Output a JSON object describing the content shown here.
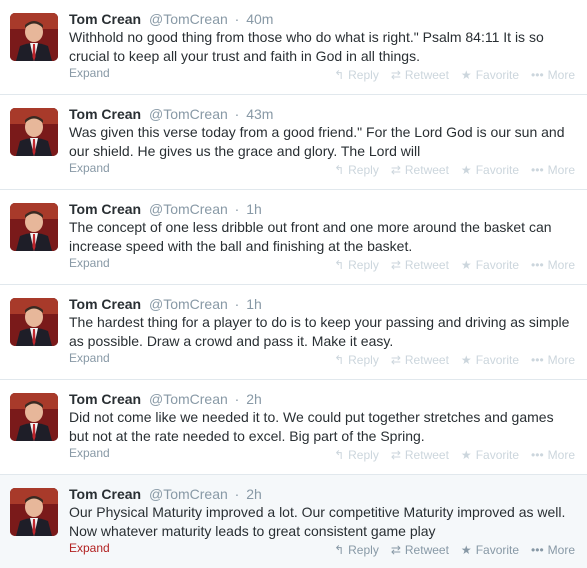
{
  "action_labels": {
    "reply": "Reply",
    "retweet": "Retweet",
    "favorite": "Favorite",
    "more": "More",
    "expand": "Expand"
  },
  "tweets": [
    {
      "fullname": "Tom Crean",
      "username": "@TomCrean",
      "time": "40m",
      "text": "Withhold no good thing from those who do what is right.\" Psalm 84:11 It is so crucial to keep all your trust and faith in God in all things."
    },
    {
      "fullname": "Tom Crean",
      "username": "@TomCrean",
      "time": "43m",
      "text": "Was given this verse today from a good friend.\" For the Lord God is our sun and our shield. He gives us the grace and glory. The Lord will"
    },
    {
      "fullname": "Tom Crean",
      "username": "@TomCrean",
      "time": "1h",
      "text": "The concept of one less dribble out front and one more around the basket can increase speed with the ball and finishing at the basket."
    },
    {
      "fullname": "Tom Crean",
      "username": "@TomCrean",
      "time": "1h",
      "text": "The hardest thing for a player to do is to keep your passing and driving as simple as possible. Draw a crowd and pass it. Make it easy."
    },
    {
      "fullname": "Tom Crean",
      "username": "@TomCrean",
      "time": "2h",
      "text": "Did not come like we needed it to. We could put together stretches and games but not at the rate needed to excel. Big part of the Spring."
    },
    {
      "fullname": "Tom Crean",
      "username": "@TomCrean",
      "time": "2h",
      "text": "Our Physical Maturity improved a lot. Our competitive Maturity improved as well. Now whatever maturity leads to great consistent game play"
    }
  ]
}
